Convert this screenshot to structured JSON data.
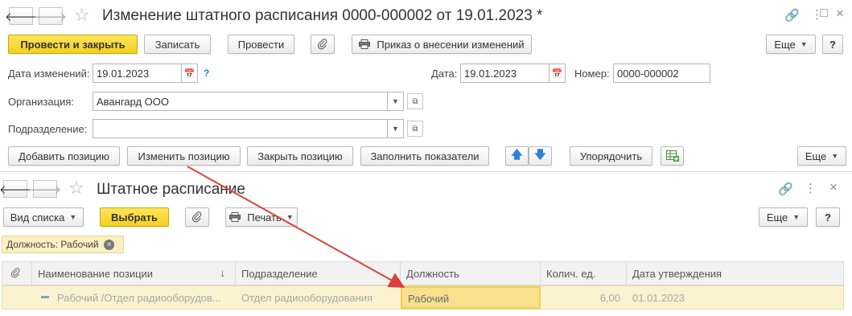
{
  "doc": {
    "title": "Изменение штатного расписания 0000-000002 от 19.01.2023 *",
    "toolbar": {
      "post_close": "Провести и закрыть",
      "save": "Записать",
      "post": "Провести",
      "order": "Приказ о внесении изменений",
      "more": "Еще",
      "help": "?"
    },
    "form": {
      "change_date_label": "Дата изменений:",
      "change_date_value": "19.01.2023",
      "date_label": "Дата:",
      "date_value": "19.01.2023",
      "number_label": "Номер:",
      "number_value": "0000-000002",
      "org_label": "Организация:",
      "org_value": "Авангард ООО",
      "dept_label": "Подразделение:",
      "dept_value": ""
    },
    "actions": {
      "add": "Добавить позицию",
      "change": "Изменить позицию",
      "close": "Закрыть позицию",
      "fill": "Заполнить показатели",
      "sort": "Упорядочить",
      "more": "Еще"
    }
  },
  "list": {
    "title": "Штатное расписание",
    "toolbar": {
      "view": "Вид списка",
      "select": "Выбрать",
      "print": "Печать",
      "more": "Еще",
      "help": "?"
    },
    "filter": "Должность: Рабочий",
    "columns": [
      "Наименование позиции",
      "Подразделение",
      "Должность",
      "Колич. ед.",
      "Дата утверждения"
    ],
    "rows": [
      {
        "name": "Рабочий /Отдел радиооборудов...",
        "dept": "Отдел радиооборудования",
        "position": "Рабочий",
        "qty": "6,00",
        "date": "01.01.2023"
      }
    ]
  },
  "colors": {
    "accent_yellow": "#f5d01f",
    "arrow_red": "#d9443a",
    "selected_row": "#fbf3cf",
    "link_blue": "#2f7fd8"
  }
}
